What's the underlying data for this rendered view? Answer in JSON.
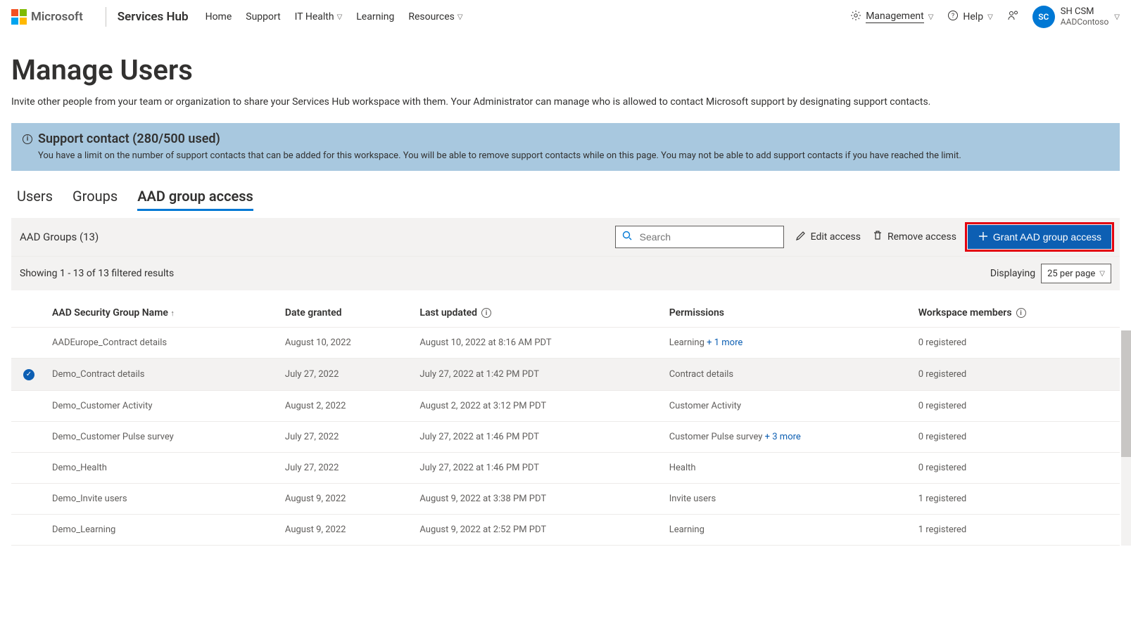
{
  "header": {
    "microsoft": "Microsoft",
    "brand": "Services Hub",
    "links": [
      {
        "label": "Home"
      },
      {
        "label": "Support"
      },
      {
        "label": "IT Health",
        "dropdown": true
      },
      {
        "label": "Learning"
      },
      {
        "label": "Resources",
        "dropdown": true
      }
    ],
    "management_label": "Management",
    "help_label": "Help",
    "profile_initials": "SC",
    "profile_name": "SH CSM",
    "profile_org": "AADContoso"
  },
  "page": {
    "title": "Manage Users",
    "description": "Invite other people from your team or organization to share your Services Hub workspace with them. Your Administrator can manage who is allowed to contact Microsoft support by designating support contacts."
  },
  "banner": {
    "title": "Support contact (280/500 used)",
    "body": "You have a limit on the number of support contacts that can be added for this workspace. You will be able to remove support contacts while on this page. You may not be able to add support contacts if you have reached the limit."
  },
  "tabs": {
    "items": [
      {
        "label": "Users"
      },
      {
        "label": "Groups"
      },
      {
        "label": "AAD group access",
        "active": true
      }
    ]
  },
  "toolbar": {
    "heading": "AAD Groups (13)",
    "search_placeholder": "Search",
    "edit_label": "Edit access",
    "remove_label": "Remove access",
    "grant_label": "Grant AAD group access"
  },
  "filterbar": {
    "showing": "Showing 1 - 13 of 13 filtered results",
    "displaying_label": "Displaying",
    "per_page": "25 per page"
  },
  "table": {
    "columns": {
      "name": "AAD Security Group Name",
      "date": "Date granted",
      "updated": "Last updated",
      "perm": "Permissions",
      "members": "Workspace members"
    },
    "rows": [
      {
        "selected": false,
        "name": "AADEurope_Contract details",
        "date": "August 10, 2022",
        "updated": "August 10, 2022 at 8:16 AM PDT",
        "perm": "Learning",
        "perm_more": "+ 1 more",
        "members": "0 registered"
      },
      {
        "selected": true,
        "name": "Demo_Contract details",
        "date": "July 27, 2022",
        "updated": "July 27, 2022 at 1:42 PM PDT",
        "perm": "Contract details",
        "perm_more": "",
        "members": "0 registered"
      },
      {
        "selected": false,
        "name": "Demo_Customer Activity",
        "date": "August 2, 2022",
        "updated": "August 2, 2022 at 3:12 PM PDT",
        "perm": "Customer Activity",
        "perm_more": "",
        "members": "0 registered"
      },
      {
        "selected": false,
        "name": "Demo_Customer Pulse survey",
        "date": "July 27, 2022",
        "updated": "July 27, 2022 at 1:46 PM PDT",
        "perm": "Customer Pulse survey",
        "perm_more": "+ 3 more",
        "members": "0 registered"
      },
      {
        "selected": false,
        "name": "Demo_Health",
        "date": "July 27, 2022",
        "updated": "July 27, 2022 at 1:46 PM PDT",
        "perm": "Health",
        "perm_more": "",
        "members": "0 registered"
      },
      {
        "selected": false,
        "name": "Demo_Invite users",
        "date": "August 9, 2022",
        "updated": "August 9, 2022 at 3:38 PM PDT",
        "perm": "Invite users",
        "perm_more": "",
        "members": "1 registered"
      },
      {
        "selected": false,
        "name": "Demo_Learning",
        "date": "August 9, 2022",
        "updated": "August 9, 2022 at 2:52 PM PDT",
        "perm": "Learning",
        "perm_more": "",
        "members": "1 registered"
      }
    ]
  }
}
